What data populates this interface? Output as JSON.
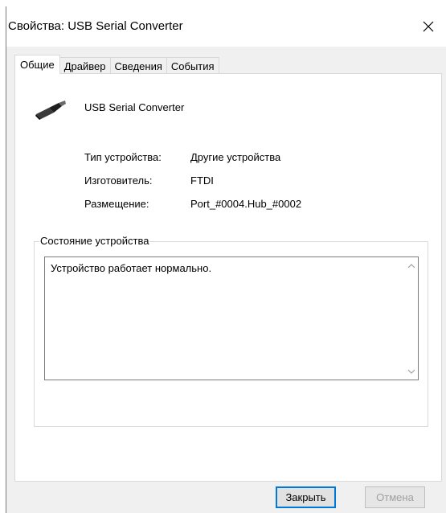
{
  "window": {
    "title": "Свойства: USB Serial Converter"
  },
  "tabs": [
    {
      "label": "Общие",
      "active": true
    },
    {
      "label": "Драйвер",
      "active": false
    },
    {
      "label": "Сведения",
      "active": false
    },
    {
      "label": "События",
      "active": false
    }
  ],
  "device": {
    "name": "USB Serial Converter",
    "icon": "usb-plug-icon"
  },
  "properties": [
    {
      "label": "Тип устройства:",
      "value": "Другие устройства"
    },
    {
      "label": "Изготовитель:",
      "value": "FTDI"
    },
    {
      "label": "Размещение:",
      "value": "Port_#0004.Hub_#0002"
    }
  ],
  "status": {
    "group_title": "Состояние устройства",
    "text": "Устройство работает нормально."
  },
  "buttons": {
    "close_label": "Закрыть",
    "cancel_label": "Отмена"
  },
  "colors": {
    "accent": "#0078d7",
    "window_bg": "#f0f0f0",
    "panel_bg": "#ffffff",
    "disabled_text": "#a0a0a0"
  }
}
